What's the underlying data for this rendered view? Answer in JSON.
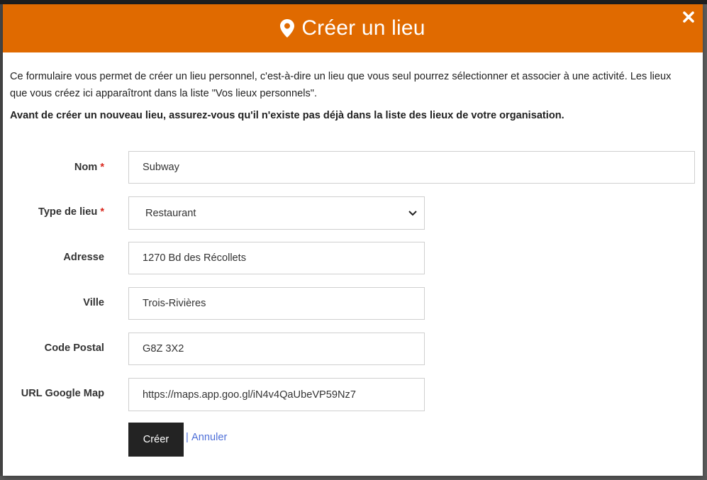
{
  "modal": {
    "title": "Créer un lieu",
    "icon": "map-pin-icon",
    "close_icon": "close-icon",
    "header_color": "#e06a00",
    "intro": "Ce formulaire vous permet de créer un lieu personnel, c'est-à-dire un lieu que vous seul pourrez sélectionner et associer à une activité. Les lieux que vous créez ici apparaîtront dans la liste \"Vos lieux personnels\".",
    "warning": "Avant de créer un nouveau lieu, assurez-vous qu'il n'existe pas déjà dans la liste des lieux de votre organisation."
  },
  "form": {
    "nom": {
      "label": "Nom",
      "required_mark": "*",
      "value": "Subway"
    },
    "type": {
      "label": "Type de lieu",
      "required_mark": "*",
      "value": "Restaurant"
    },
    "adresse": {
      "label": "Adresse",
      "value": "1270 Bd des Récollets"
    },
    "ville": {
      "label": "Ville",
      "value": "Trois-Rivières"
    },
    "code_postal": {
      "label": "Code Postal",
      "value": "G8Z 3X2"
    },
    "url_map": {
      "label": "URL Google Map",
      "value": "https://maps.app.goo.gl/iN4v4QaUbeVP59Nz7"
    }
  },
  "actions": {
    "create": "Créer",
    "separator": "|",
    "cancel": "Annuler"
  }
}
